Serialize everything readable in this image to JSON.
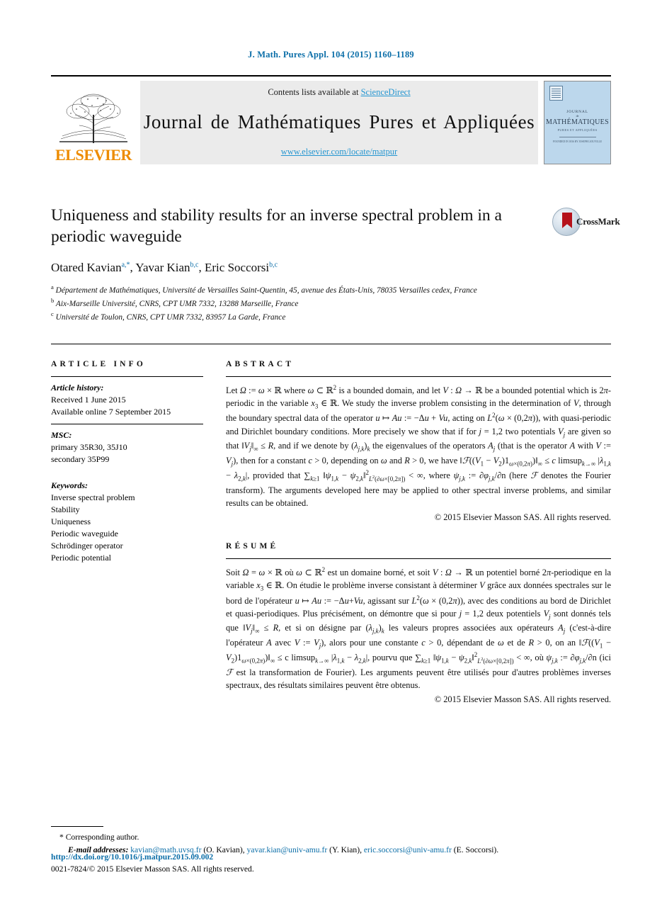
{
  "running_head": "J. Math. Pures Appl. 104 (2015) 1160–1189",
  "masthead": {
    "contents_prefix": "Contents lists available at ",
    "sciencedirect": "ScienceDirect",
    "journal_name": "Journal de Mathématiques Pures et Appliquées",
    "journal_url": "www.elsevier.com/locate/matpur",
    "publisher_wordmark": "ELSEVIER",
    "cover": {
      "line1": "JOURNAL",
      "line2": "de",
      "line3": "MATHÉMATIQUES",
      "line4": "PURES ET APPLIQUÉES",
      "line5": "FOUNDED IN 1836 BY JOSEPH LIOUVILLE"
    },
    "accent_blue": "#2596d1",
    "band_gray": "#ebebeb",
    "elsevier_orange": "#ED8B00"
  },
  "article": {
    "title": "Uniqueness and stability results for an inverse spectral problem in a periodic waveguide",
    "crossmark_label": "CrossMark",
    "authors": [
      {
        "name": "Otared Kavian",
        "marks": "a,*"
      },
      {
        "name": "Yavar Kian",
        "marks": "b,c"
      },
      {
        "name": "Eric Soccorsi",
        "marks": "b,c"
      }
    ],
    "authors_separator": ", ",
    "affiliations": [
      {
        "mark": "a",
        "text": "Département de Mathématiques, Université de Versailles Saint-Quentin, 45, avenue des États-Unis, 78035 Versailles cedex, France"
      },
      {
        "mark": "b",
        "text": "Aix-Marseille Université, CNRS, CPT UMR 7332, 13288 Marseille, France"
      },
      {
        "mark": "c",
        "text": "Université de Toulon, CNRS, CPT UMR 7332, 83957 La Garde, France"
      }
    ]
  },
  "article_info": {
    "heading": "ARTICLE INFO",
    "history_label": "Article history:",
    "history": [
      "Received 1 June 2015",
      "Available online 7 September 2015"
    ],
    "msc_label": "MSC:",
    "msc": [
      "primary 35R30, 35J10",
      "secondary 35P99"
    ],
    "keywords_label": "Keywords:",
    "keywords": [
      "Inverse spectral problem",
      "Stability",
      "Uniqueness",
      "Periodic waveguide",
      "Schrödinger operator",
      "Periodic potential"
    ]
  },
  "abstract": {
    "heading": "ABSTRACT",
    "text_plain": "Let Ω := ω × ℝ where ω ⊂ ℝ² is a bounded domain, and let V : Ω → ℝ be a bounded potential which is 2π-periodic in the variable x₃ ∈ ℝ. We study the inverse problem consisting in the determination of V, through the boundary spectral data of the operator u ↦ Au := −Δu + Vu, acting on L²(ω × (0,2π)), with quasi-periodic and Dirichlet boundary conditions. More precisely we show that if for j = 1,2 two potentials Vⱼ are given so that ‖Vⱼ‖∞ ≤ R, and if we denote by (λⱼ,ₖ)ₖ the eigenvalues of the operators Aⱼ (that is the operator A with V := Vⱼ), then for a constant c > 0, depending on ω and R > 0, we have ‖ℱ((V₁ − V₂)1ω×(0,2π))‖∞ ≤ c limsup_{k→∞} |λ₁,ₖ − λ₂,ₖ|, provided that ∑_{k≥1} ‖ψ₁,ₖ − ψ₂,ₖ‖²_{L²(∂ω×[0,2π])} < ∞, where ψⱼ,ₖ := ∂φⱼ,ₖ/∂n (here ℱ denotes the Fourier transform). The arguments developed here may be applied to other spectral inverse problems, and similar results can be obtained.",
    "copyright": "© 2015 Elsevier Masson SAS. All rights reserved."
  },
  "resume": {
    "heading": "RÉSUMÉ",
    "text_plain": "Soit Ω = ω × ℝ où ω ⊂ ℝ² est un domaine borné, et soit V : Ω → ℝ un potentiel borné 2π-periodique en la variable x₃ ∈ ℝ. On étudie le problème inverse consistant à déterminer V grâce aux données spectrales sur le bord de l'opérateur u ↦ Au := −Δu + Vu, agissant sur L²(ω × (0,2π)), avec des conditions au bord de Dirichlet et quasi-periodiques. Plus précisément, on démontre que si pour j = 1,2 deux potentiels Vⱼ sont donnés tels que ‖Vⱼ‖∞ ≤ R, et si on désigne par (λⱼ,ₖ)ₖ les valeurs propres associées aux opérateurs Aⱼ (c'est-à-dire l'opérateur A avec V := Vⱼ), alors pour une constante c > 0, dépendant de ω et de R > 0, on an ‖ℱ((V₁ − V₂)1ω×(0,2π))‖∞ ≤ c limsup_{k→∞} |λ₁,ₖ − λ₂,ₖ|, pourvu que ∑_{k≥1} ‖ψ₁,ₖ − ψ₂,ₖ‖²_{L²(∂ω×[0,2π])} < ∞, où ψⱼ,ₖ := ∂φⱼ,ₖ/∂n (ici ℱ est la transformation de Fourier). Les arguments peuvent être utilisés pour d'autres problèmes inverses spectraux, des résultats similaires peuvent être obtenus.",
    "copyright": "© 2015 Elsevier Masson SAS. All rights reserved."
  },
  "footnotes": {
    "corresponding_mark": "*",
    "corresponding_text": "Corresponding author.",
    "email_label": "E-mail addresses:",
    "emails": [
      {
        "address": "kavian@math.uvsq.fr",
        "who": "(O. Kavian)"
      },
      {
        "address": "yavar.kian@univ-amu.fr",
        "who": "(Y. Kian)"
      },
      {
        "address": "eric.soccorsi@univ-amu.fr",
        "who": "(E. Soccorsi)."
      }
    ]
  },
  "footer": {
    "doi": "http://dx.doi.org/10.1016/j.matpur.2015.09.002",
    "issn_line": "0021-7824/© 2015 Elsevier Masson SAS. All rights reserved."
  }
}
